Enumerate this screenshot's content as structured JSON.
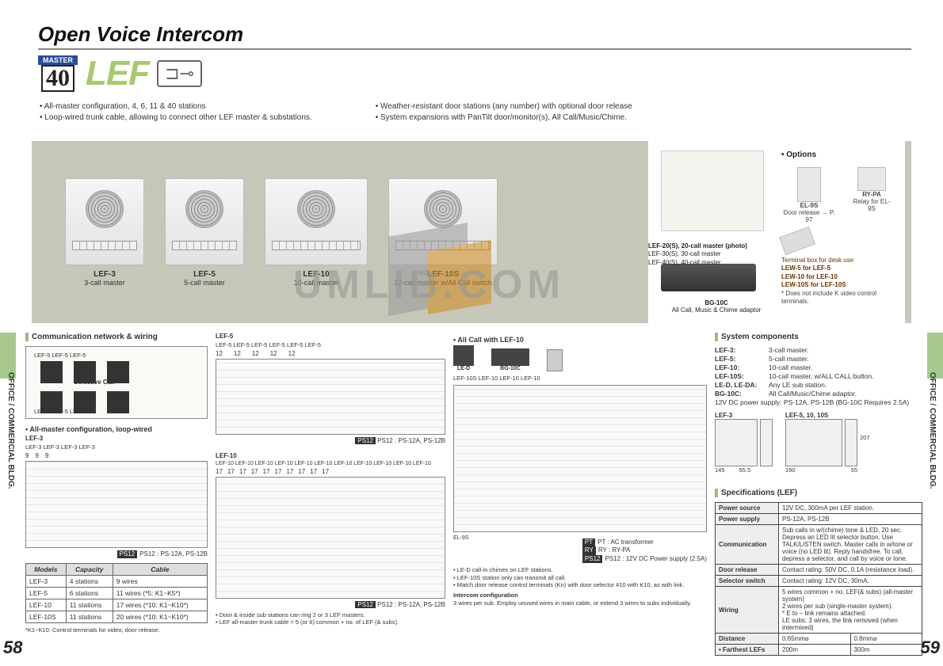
{
  "title": "Open Voice Intercom",
  "badge": {
    "label": "MASTER",
    "number": "40"
  },
  "series": "LEF",
  "features_left": [
    "All-master configuration, 4, 6, 11 & 40 stations",
    "Loop-wired trunk cable, allowing to connect other LEF master & substations."
  ],
  "features_right": [
    "Weather-resistant door stations (any number) with optional door release",
    "System expansions with PanTilt door/monitor(s), All Call/Music/Chime."
  ],
  "products": [
    {
      "name": "LEF-3",
      "sub": "3-call master"
    },
    {
      "name": "LEF-5",
      "sub": "5-call master"
    },
    {
      "name": "LEF-10",
      "sub": "10-call master"
    },
    {
      "name": "LEF-10S",
      "sub": "10-call master w/All Call switch"
    }
  ],
  "rp_masters": [
    "LEF-20(S), 20-call master (photo)",
    "LEF-30(S), 30-call master",
    "LEF-40(S), 40-call master"
  ],
  "bg10c": {
    "name": "BG-10C",
    "sub": "All Call, Music & Chime adaptor"
  },
  "options_title": "• Options",
  "options": [
    {
      "name": "EL-9S",
      "sub": "Door release → P. 97"
    },
    {
      "name": "RY-PA",
      "sub": "Relay for EL-9S"
    }
  ],
  "terminal_note": {
    "title": "Terminal box for desk use",
    "lines": [
      "LEW-5 for LEF-5",
      "LEW-10 for LEF-10",
      "LEW-10S for LEF-10S"
    ],
    "asterisk": "* Does not include K video control terminals."
  },
  "side_label": "OFFICE / COMMERCIAL BLDG.",
  "page_left": "58",
  "page_right": "59",
  "watermark": "UMLIB.COM",
  "sec_comm": "Communication network & wiring",
  "sec_syscomp": "System components",
  "sec_spec": "Specifications (LEF)",
  "diag_selective": "Selective Call",
  "diag_allmaster": "• All-master configuration, loop-wired",
  "diag_lef3": "LEF-3",
  "diag_lef5": "LEF-5",
  "diag_lef10": "LEF-10",
  "diag_allcall": "• All Call with LEF-10",
  "diag_lef5_units": "LEF-5   LEF-5   LEF-5   LEF-5   LEF-5   LEF-5",
  "diag_lef10_units": "LEF-10 LEF-10 LEF-10 LEF-10 LEF-10 LEF-10 LEF-10 LEF-10 LEF-10 LEF-10 LEF-10",
  "diag_lef3_units": "LEF-3   LEF-3   LEF-3   LEF-3",
  "diag_top_units": "LEF-5   LEF-5   LEF-5",
  "diag_top_units2": "LEF-5   LEF-5   LEF-5",
  "ps12_a": "PS12 : PS-12A, PS-12B",
  "ps12_b": "PS12 : PS-12A, PS-12B",
  "ps12_c": "PS12 : PS-12A, PS-12B",
  "wire_count_12": "12",
  "wire_count_9": "9",
  "wire_count_17": "17",
  "led_label": "LE-D",
  "bg10c_label2": "BG-10C",
  "el9s_label": "EL-9S",
  "allcall_units": "LEF-10S  LEF-10   LEF-10   LEF-10",
  "legend_pt": "PT : AC transformer",
  "legend_ry": "RY : RY-PA",
  "legend_ps": "PS12 : 12V DC Power supply (2.5A)",
  "door_note1": "• Door & inside sub stations can ring 2 or 3 LEF masters.",
  "door_note2": "• LEF all-master trunk cable = 5 (or 6) common + no. of LEF (& subs).",
  "led_note1": "• LE-D call-in chimes on LEF stations.",
  "led_note2": "• LEF-10S station only can transmit all call.",
  "led_note3": "• Match door release control terminals (Kn) with door selector #10 with K10, as with link.",
  "intercom_title": "Intercom configuration",
  "intercom_note": "3 wires per sub. Employ unused wires in main cable, or extend 3 wires to subs individually.",
  "models": {
    "headers": [
      "Models",
      "Capacity",
      "Cable"
    ],
    "rows": [
      [
        "LEF-3",
        "4 stations",
        "9 wires"
      ],
      [
        "LEF-5",
        "6 stations",
        "11 wires (*5: K1~K5*)"
      ],
      [
        "LEF-10",
        "11 stations",
        "17 wires (*10: K1~K10*)"
      ],
      [
        "LEF-10S",
        "11 stations",
        "20 wires (*10: K1~K10*)"
      ]
    ],
    "footnote": "*K1~K10: Control terminals for video, door release."
  },
  "syscomp": [
    [
      "LEF-3:",
      "3-call master."
    ],
    [
      "LEF-5:",
      "5-call master."
    ],
    [
      "LEF-10:",
      "10-call master."
    ],
    [
      "LEF-10S:",
      "10-call master, w/ALL CALL button."
    ],
    [
      "LE-D, LE-DA:",
      "Any LE sub station."
    ],
    [
      "BG-10C:",
      "All Call/Music/Chime adaptor."
    ]
  ],
  "syscomp_ps": "12V DC power supply: PS-12A, PS-12B (BG-10C Requires 2.5A)",
  "dim_lef3": "LEF-3",
  "dim_lef5": "LEF-5, 10, 10S",
  "dim_145": "145",
  "dim_555": "55.5",
  "dim_190": "190",
  "dim_55": "55",
  "dim_207": "207",
  "spec_rows": [
    [
      "Power source",
      "12V DC, 300mA per LEF station."
    ],
    [
      "Power supply",
      "PS-12A, PS-12B"
    ],
    [
      "Communication",
      "Sub calls in w/(chime) tone & LED, 20 sec. Depress an LED lit selector button. Use TALK/LISTEN switch. Master calls in w/tone or voice (no LED lit). Reply handsfree. To call, depress a selector, and call by voice or tone."
    ],
    [
      "Door release",
      "Contact rating: 50V DC, 0.1A (resistance load)."
    ],
    [
      "Selector switch",
      "Contact rating: 12V DC, 30mA."
    ],
    [
      "Wiring",
      "5 wires common + no. LEF(& subs) (all-master system)\n2 wires per sub (single-master system).\n* E to – link remains attached.\nLE subs: 3 wires, the link removed (when intermixed)"
    ]
  ],
  "spec_distance": {
    "label": "Distance",
    "c1": "0.65mm⌀",
    "c2": "0.8mm⌀"
  },
  "spec_farthest": {
    "label": "• Farthest LEFs",
    "c1": "200m",
    "c2": "300m"
  }
}
